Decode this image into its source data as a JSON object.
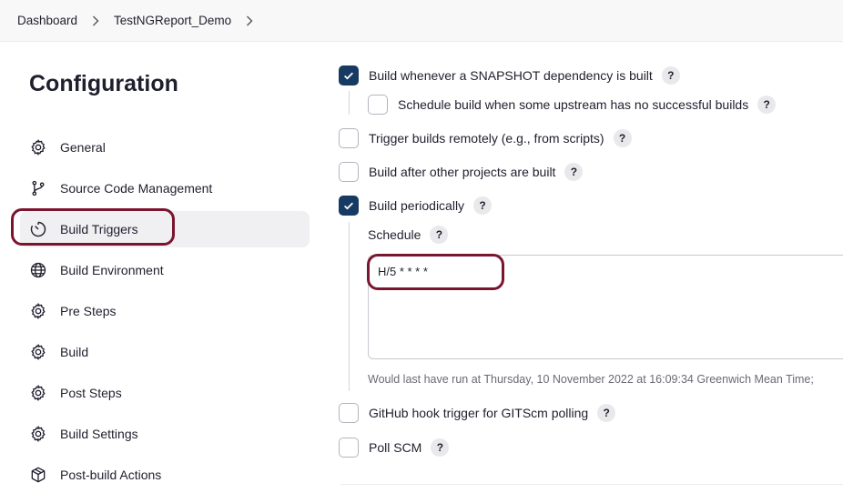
{
  "breadcrumb": {
    "items": [
      "Dashboard",
      "TestNGReport_Demo"
    ]
  },
  "sidebar": {
    "title": "Configuration",
    "items": [
      {
        "label": "General",
        "icon": "gear-icon"
      },
      {
        "label": "Source Code Management",
        "icon": "branch-icon"
      },
      {
        "label": "Build Triggers",
        "icon": "timer-icon",
        "active": true
      },
      {
        "label": "Build Environment",
        "icon": "globe-icon"
      },
      {
        "label": "Pre Steps",
        "icon": "gear-icon"
      },
      {
        "label": "Build",
        "icon": "gear-icon"
      },
      {
        "label": "Post Steps",
        "icon": "gear-icon"
      },
      {
        "label": "Build Settings",
        "icon": "gear-icon"
      },
      {
        "label": "Post-build Actions",
        "icon": "cube-icon"
      }
    ]
  },
  "triggers": {
    "snapshot": {
      "label": "Build whenever a SNAPSHOT dependency is built",
      "checked": true
    },
    "upstream": {
      "label": "Schedule build when some upstream has no successful builds",
      "checked": false
    },
    "remote": {
      "label": "Trigger builds remotely (e.g., from scripts)",
      "checked": false
    },
    "after_other": {
      "label": "Build after other projects are built",
      "checked": false
    },
    "periodic": {
      "label": "Build periodically",
      "checked": true
    },
    "github": {
      "label": "GitHub hook trigger for GITScm polling",
      "checked": false
    },
    "poll_scm": {
      "label": "Poll SCM",
      "checked": false
    }
  },
  "schedule": {
    "label": "Schedule",
    "value": "H/5 * * * *",
    "hint": "Would last have run at Thursday, 10 November 2022 at 16:09:34 Greenwich Mean Time;"
  },
  "help_glyph": "?",
  "colors": {
    "checkbox_checked": "#173a63",
    "highlight": "#7a1530",
    "active_nav_bg": "#f0f0f2"
  }
}
